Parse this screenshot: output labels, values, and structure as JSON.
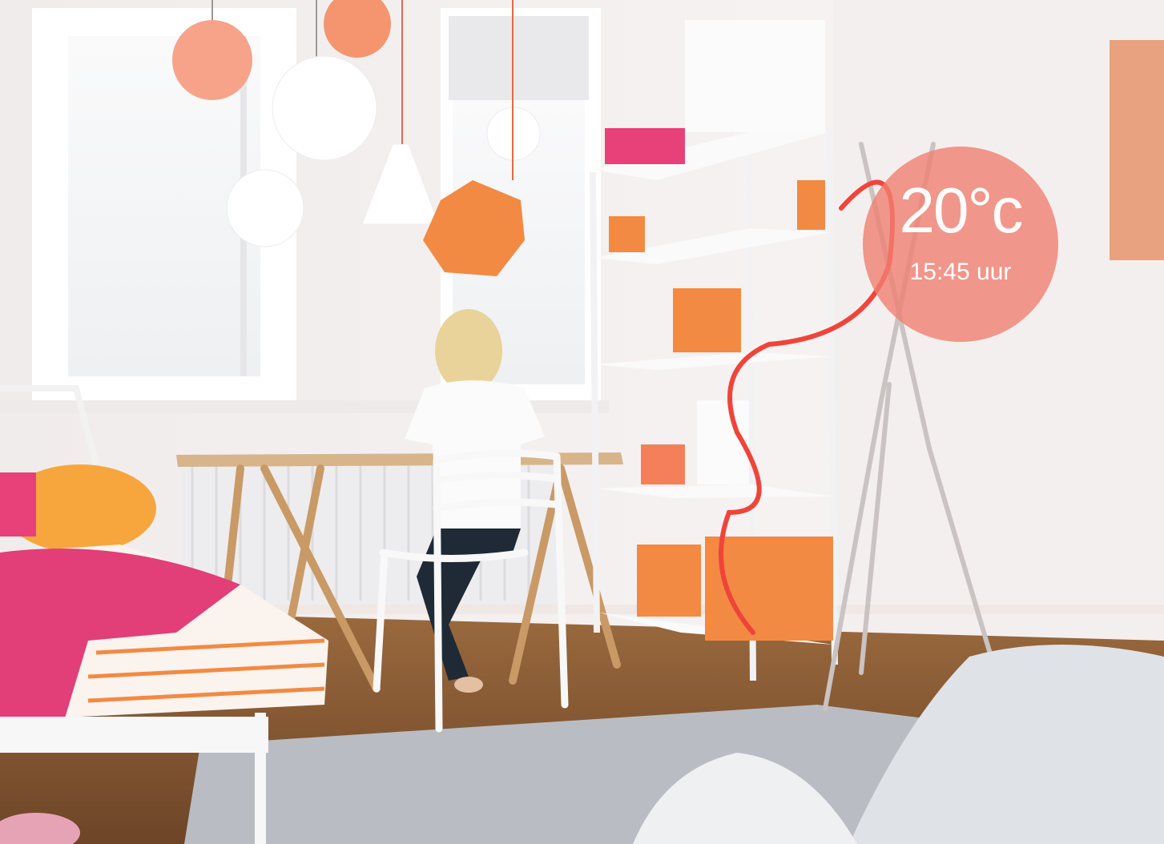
{
  "scene": {
    "description_tag": "bedroom-photo",
    "colors": {
      "wall": "#f3eeee",
      "window_light": "#f7f7f8",
      "accent_orange": "#f28a43",
      "accent_pink": "#e8417a",
      "overlay": "#f08070",
      "floor": "#8a5a33",
      "rug": "#b9bcc3"
    }
  },
  "widget": {
    "temperature": "20°c",
    "time": "15:45 uur"
  }
}
